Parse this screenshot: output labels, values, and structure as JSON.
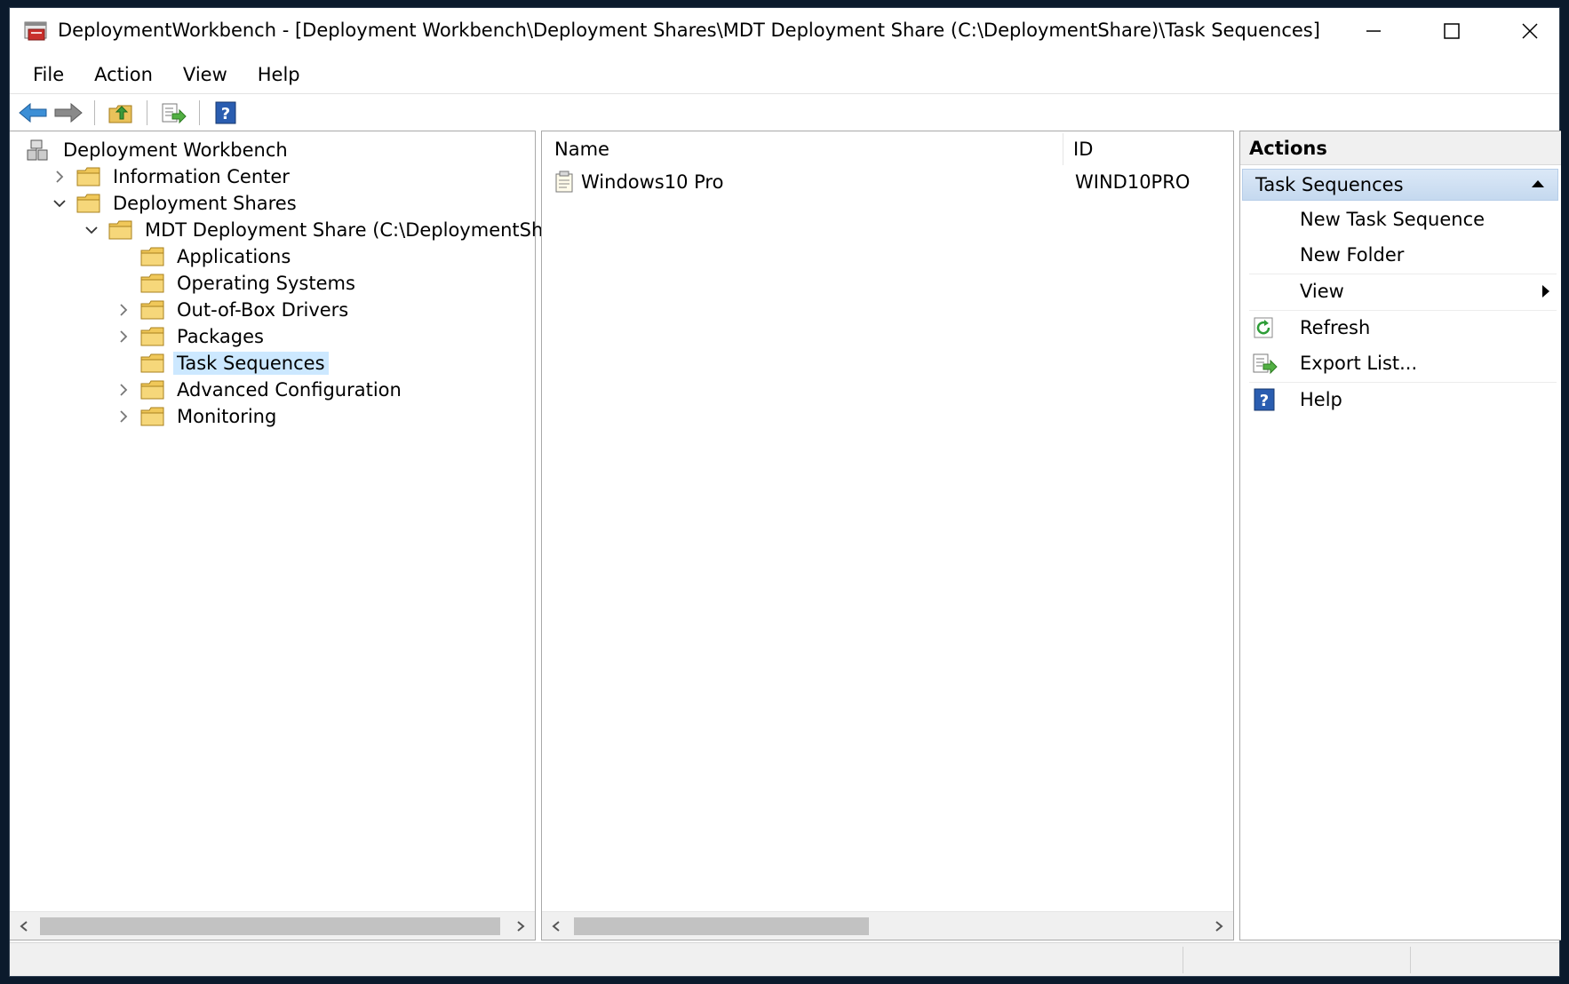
{
  "window": {
    "title": "DeploymentWorkbench - [Deployment Workbench\\Deployment Shares\\MDT Deployment Share (C:\\DeploymentShare)\\Task Sequences]"
  },
  "menu": [
    "File",
    "Action",
    "View",
    "Help"
  ],
  "toolbar": {
    "icons": [
      "back-arrow-icon",
      "forward-arrow-icon",
      "up-folder-icon",
      "export-list-icon",
      "help-icon"
    ]
  },
  "tree": {
    "items": [
      {
        "label": "Deployment Workbench",
        "level": 0,
        "expander": "none",
        "icon": "workbench-icon"
      },
      {
        "label": "Information Center",
        "level": 1,
        "expander": "collapsed",
        "icon": "folder-icon"
      },
      {
        "label": "Deployment Shares",
        "level": 1,
        "expander": "expanded",
        "icon": "folder-icon"
      },
      {
        "label": "MDT Deployment Share (C:\\DeploymentShare)",
        "level": 2,
        "expander": "expanded",
        "icon": "folder-icon"
      },
      {
        "label": "Applications",
        "level": 3,
        "expander": "none",
        "icon": "folder-icon"
      },
      {
        "label": "Operating Systems",
        "level": 3,
        "expander": "none",
        "icon": "folder-icon"
      },
      {
        "label": "Out-of-Box Drivers",
        "level": 3,
        "expander": "collapsed",
        "icon": "folder-icon"
      },
      {
        "label": "Packages",
        "level": 3,
        "expander": "collapsed",
        "icon": "folder-icon"
      },
      {
        "label": "Task Sequences",
        "level": 3,
        "expander": "none",
        "icon": "folder-icon",
        "selected": true
      },
      {
        "label": "Advanced Configuration",
        "level": 3,
        "expander": "collapsed",
        "icon": "folder-icon"
      },
      {
        "label": "Monitoring",
        "level": 3,
        "expander": "collapsed",
        "icon": "folder-icon"
      }
    ]
  },
  "list": {
    "columns": [
      "Name",
      "ID"
    ],
    "rows": [
      {
        "name": "Windows10 Pro",
        "id": "WIND10PRO"
      }
    ]
  },
  "actions": {
    "title": "Actions",
    "group": "Task Sequences",
    "items": [
      {
        "label": "New Task Sequence",
        "icon": ""
      },
      {
        "label": "New Folder",
        "icon": ""
      },
      {
        "label": "View",
        "icon": "",
        "submenu": true
      },
      {
        "label": "Refresh",
        "icon": "refresh-icon"
      },
      {
        "label": "Export List...",
        "icon": "export-list-icon"
      },
      {
        "label": "Help",
        "icon": "help-icon"
      }
    ]
  },
  "colors": {
    "selection": "#cce8ff",
    "actions_group": "#c5d9ef",
    "desktop": "#0b1a2c"
  }
}
